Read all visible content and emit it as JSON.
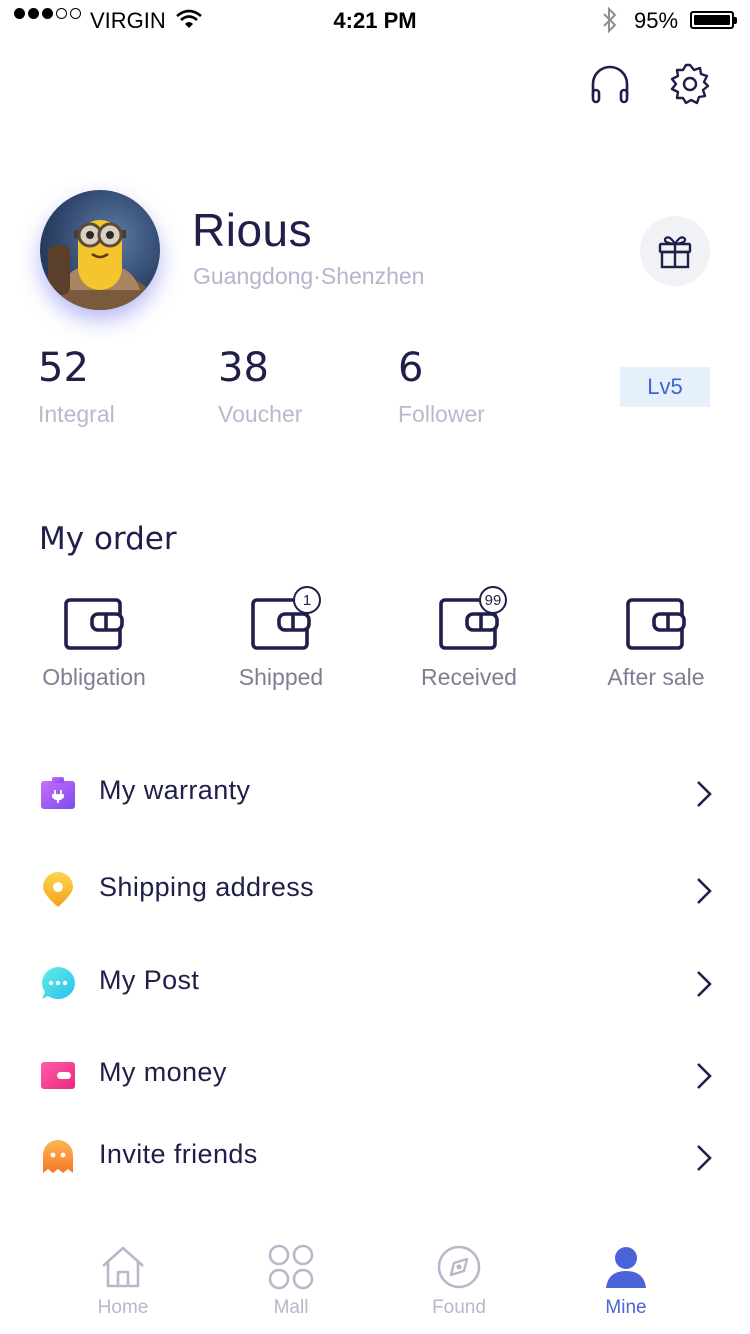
{
  "status_bar": {
    "carrier": "VIRGIN",
    "time": "4:21 PM",
    "battery": "95%"
  },
  "top_actions": {
    "support_icon": "headphones-icon",
    "settings_icon": "gear-icon"
  },
  "profile": {
    "name": "Rious",
    "location": "Guangdong·Shenzhen",
    "level": "Lv5",
    "gift_icon": "gift-icon"
  },
  "stats": [
    {
      "value": "52",
      "label": "Integral"
    },
    {
      "value": "38",
      "label": "Voucher"
    },
    {
      "value": "6",
      "label": "Follower"
    }
  ],
  "orders": {
    "title": "My order",
    "items": [
      {
        "label": "Obligation",
        "badge": ""
      },
      {
        "label": "Shipped",
        "badge": "1"
      },
      {
        "label": "Received",
        "badge": "99"
      },
      {
        "label": "After sale",
        "badge": ""
      }
    ]
  },
  "menu": [
    {
      "label": "My warranty",
      "icon": "warranty-icon",
      "color": "#a160f5"
    },
    {
      "label": "Shipping address",
      "icon": "location-pin-icon",
      "color": "#f7c93a"
    },
    {
      "label": "My Post",
      "icon": "chat-bubble-icon",
      "color": "#37d6ef"
    },
    {
      "label": "My money",
      "icon": "wallet-icon",
      "color": "#f24a9a"
    },
    {
      "label": "Invite friends",
      "icon": "ghost-icon",
      "color": "#f89a3c"
    }
  ],
  "tabs": [
    {
      "label": "Home",
      "icon": "home-icon",
      "active": false
    },
    {
      "label": "Mall",
      "icon": "grid-icon",
      "active": false
    },
    {
      "label": "Found",
      "icon": "compass-icon",
      "active": false
    },
    {
      "label": "Mine",
      "icon": "user-icon",
      "active": true
    }
  ],
  "colors": {
    "primary_text": "#1f1f4a",
    "accent": "#4a63d8",
    "muted": "#b8bacb"
  }
}
